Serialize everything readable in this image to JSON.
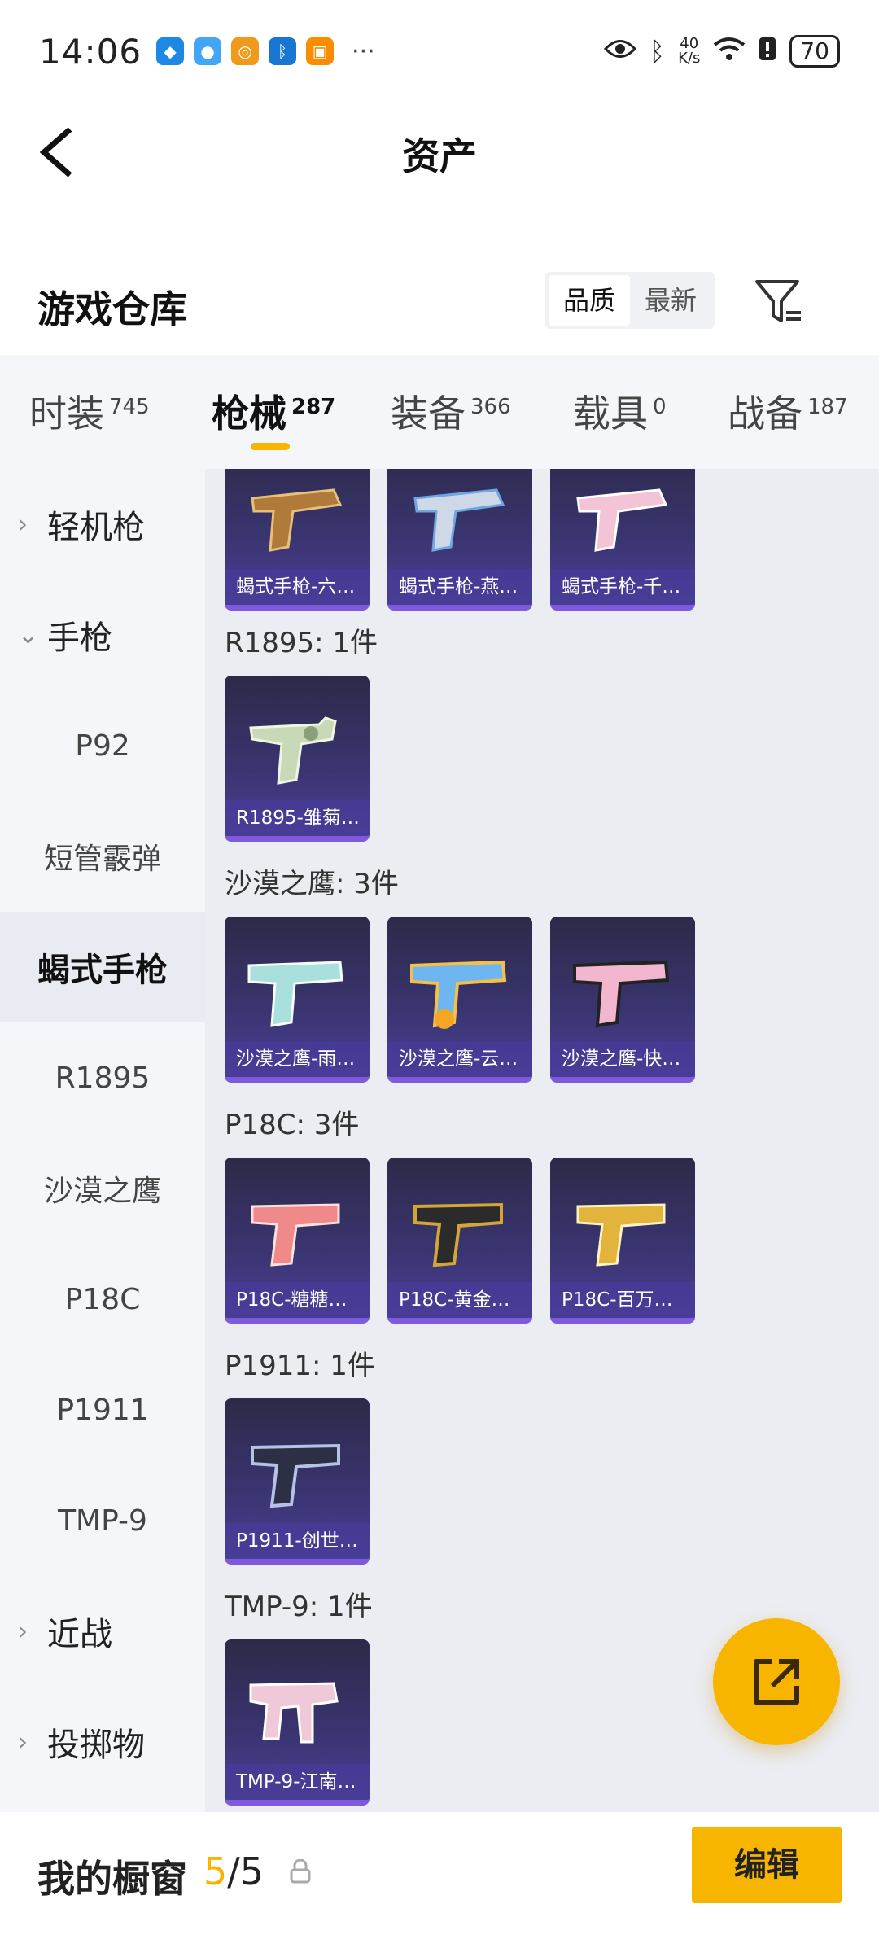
{
  "status_bar": {
    "time": "14:06",
    "more": "···",
    "net_speed_value": "40",
    "net_speed_unit": "K/s",
    "battery": "70"
  },
  "header": {
    "back_icon": "chevron-left-icon",
    "title": "资产"
  },
  "warehouse": {
    "title": "游戏仓库",
    "sort_options": [
      "品质",
      "最新"
    ],
    "selected_sort": "品质"
  },
  "tabs": [
    {
      "label": "时装",
      "count": "745"
    },
    {
      "label": "枪械",
      "count": "287",
      "active": true
    },
    {
      "label": "装备",
      "count": "366"
    },
    {
      "label": "载具",
      "count": "0"
    },
    {
      "label": "战备",
      "count": "187"
    }
  ],
  "sidebar": {
    "items": [
      {
        "label": "轻机枪",
        "type": "group",
        "chevron": "›"
      },
      {
        "label": "手枪",
        "type": "group",
        "chevron": "⌄"
      },
      {
        "label": "P92",
        "type": "sub"
      },
      {
        "label": "短管霰弹",
        "type": "sub"
      },
      {
        "label": "蝎式手枪",
        "type": "sub",
        "active": true
      },
      {
        "label": "R1895",
        "type": "sub"
      },
      {
        "label": "沙漠之鹰",
        "type": "sub"
      },
      {
        "label": "P18C",
        "type": "sub"
      },
      {
        "label": "P1911",
        "type": "sub"
      },
      {
        "label": "TMP-9",
        "type": "sub"
      },
      {
        "label": "近战",
        "type": "group",
        "chevron": "›"
      },
      {
        "label": "投掷物",
        "type": "group",
        "chevron": "›"
      }
    ]
  },
  "content": {
    "top_cards": [
      "蝎式手枪-六…",
      "蝎式手枪-燕…",
      "蝎式手枪-千…"
    ],
    "groups": [
      {
        "label": "R1895: 1件",
        "cards": [
          "R1895-雏菊…"
        ]
      },
      {
        "label": "沙漠之鹰: 3件",
        "cards": [
          "沙漠之鹰-雨…",
          "沙漠之鹰-云…",
          "沙漠之鹰-快…"
        ]
      },
      {
        "label": "P18C: 3件",
        "cards": [
          "P18C-糖糖…",
          "P18C-黄金…",
          "P18C-百万…"
        ]
      },
      {
        "label": "P1911: 1件",
        "cards": [
          "P1911-创世…"
        ]
      },
      {
        "label": "TMP-9: 1件",
        "cards": [
          "TMP-9-江南…"
        ]
      }
    ]
  },
  "bottom": {
    "showcase_label": "我的橱窗",
    "showcase_current": "5",
    "showcase_total": "/5",
    "edit_label": "编辑"
  },
  "colors": {
    "accent": "#f7b500",
    "card_bg": "#3a3572",
    "card_border": "#7d5bdc"
  }
}
